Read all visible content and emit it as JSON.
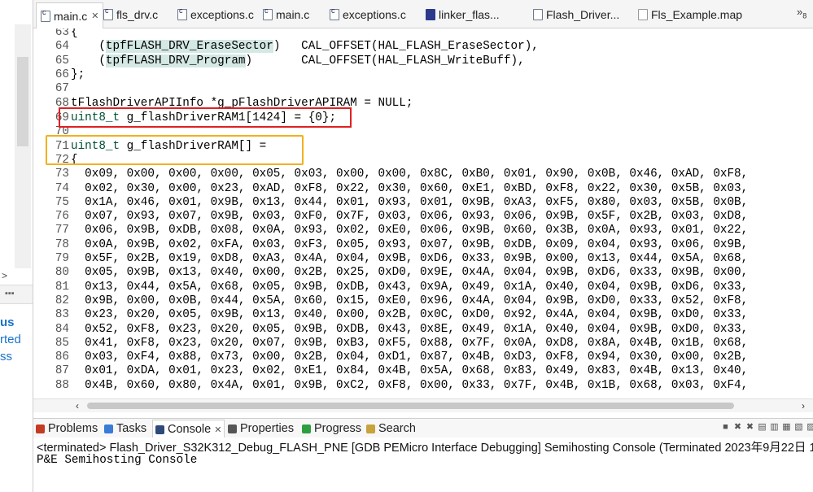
{
  "left_panel": {
    "fragments": [
      "us",
      "rted",
      "ss"
    ]
  },
  "editor_tabs": [
    {
      "label": "main.c",
      "icon": "c-file-icon",
      "active": true
    },
    {
      "label": "fls_drv.c",
      "icon": "c-file-icon"
    },
    {
      "label": "exceptions.c",
      "icon": "c-file-icon"
    },
    {
      "label": "main.c",
      "icon": "c-file-icon"
    },
    {
      "label": "exceptions.c",
      "icon": "c-file-icon"
    },
    {
      "label": "linker_flas...",
      "icon": "linker-file-icon"
    },
    {
      "label": "Flash_Driver...",
      "icon": "file-icon"
    },
    {
      "label": "Fls_Example.map",
      "icon": "map-file-icon"
    }
  ],
  "tab_overflow": {
    "symbol": "»",
    "count": "8"
  },
  "code_lines": [
    {
      "num": "63",
      "text": "{"
    },
    {
      "num": "64",
      "pre": "    (",
      "hl": "tpfFLASH_DRV_EraseSector",
      "post": ")   CAL_OFFSET(HAL_FLASH_EraseSector),"
    },
    {
      "num": "65",
      "pre": "    (",
      "hl": "tpfFLASH_DRV_Program",
      "post": ")       CAL_OFFSET(HAL_FLASH_WriteBuff),"
    },
    {
      "num": "66",
      "text": "};"
    },
    {
      "num": "67",
      "text": ""
    },
    {
      "num": "68",
      "text": "tFlashDriverAPIInfo *g_pFlashDriverAPIRAM = NULL;"
    },
    {
      "num": "69",
      "kw": "uint8_t",
      "text": " g_flashDriverRAM1[1424] = {0};"
    },
    {
      "num": "70",
      "text": ""
    },
    {
      "num": "71",
      "kw": "uint8_t",
      "text": " g_flashDriverRAM[] ="
    },
    {
      "num": "72",
      "text": "{"
    },
    {
      "num": "73",
      "text": "  0x09, 0x00, 0x00, 0x00, 0x05, 0x03, 0x00, 0x00, 0x8C, 0xB0, 0x01, 0x90, 0x0B, 0x46, 0xAD, 0xF8,"
    },
    {
      "num": "74",
      "text": "  0x02, 0x30, 0x00, 0x23, 0xAD, 0xF8, 0x22, 0x30, 0x60, 0xE1, 0xBD, 0xF8, 0x22, 0x30, 0x5B, 0x03,"
    },
    {
      "num": "75",
      "text": "  0x1A, 0x46, 0x01, 0x9B, 0x13, 0x44, 0x01, 0x93, 0x01, 0x9B, 0xA3, 0xF5, 0x80, 0x03, 0x5B, 0x0B,"
    },
    {
      "num": "76",
      "text": "  0x07, 0x93, 0x07, 0x9B, 0x03, 0xF0, 0x7F, 0x03, 0x06, 0x93, 0x06, 0x9B, 0x5F, 0x2B, 0x03, 0xD8,"
    },
    {
      "num": "77",
      "text": "  0x06, 0x9B, 0xDB, 0x08, 0x0A, 0x93, 0x02, 0xE0, 0x06, 0x9B, 0x60, 0x3B, 0x0A, 0x93, 0x01, 0x22,"
    },
    {
      "num": "78",
      "text": "  0x0A, 0x9B, 0x02, 0xFA, 0x03, 0xF3, 0x05, 0x93, 0x07, 0x9B, 0xDB, 0x09, 0x04, 0x93, 0x06, 0x9B,"
    },
    {
      "num": "79",
      "text": "  0x5F, 0x2B, 0x19, 0xD8, 0xA3, 0x4A, 0x04, 0x9B, 0xD6, 0x33, 0x9B, 0x00, 0x13, 0x44, 0x5A, 0x68,"
    },
    {
      "num": "80",
      "text": "  0x05, 0x9B, 0x13, 0x40, 0x00, 0x2B, 0x25, 0xD0, 0x9E, 0x4A, 0x04, 0x9B, 0xD6, 0x33, 0x9B, 0x00,"
    },
    {
      "num": "81",
      "text": "  0x13, 0x44, 0x5A, 0x68, 0x05, 0x9B, 0xDB, 0x43, 0x9A, 0x49, 0x1A, 0x40, 0x04, 0x9B, 0xD6, 0x33,"
    },
    {
      "num": "82",
      "text": "  0x9B, 0x00, 0x0B, 0x44, 0x5A, 0x60, 0x15, 0xE0, 0x96, 0x4A, 0x04, 0x9B, 0xD0, 0x33, 0x52, 0xF8,"
    },
    {
      "num": "83",
      "text": "  0x23, 0x20, 0x05, 0x9B, 0x13, 0x40, 0x00, 0x2B, 0x0C, 0xD0, 0x92, 0x4A, 0x04, 0x9B, 0xD0, 0x33,"
    },
    {
      "num": "84",
      "text": "  0x52, 0xF8, 0x23, 0x20, 0x05, 0x9B, 0xDB, 0x43, 0x8E, 0x49, 0x1A, 0x40, 0x04, 0x9B, 0xD0, 0x33,"
    },
    {
      "num": "85",
      "text": "  0x41, 0xF8, 0x23, 0x20, 0x07, 0x9B, 0xB3, 0xF5, 0x88, 0x7F, 0x0A, 0xD8, 0x8A, 0x4B, 0x1B, 0x68,"
    },
    {
      "num": "86",
      "text": "  0x03, 0xF4, 0x88, 0x73, 0x00, 0x2B, 0x04, 0xD1, 0x87, 0x4B, 0xD3, 0xF8, 0x94, 0x30, 0x00, 0x2B,"
    },
    {
      "num": "87",
      "text": "  0x01, 0xDA, 0x01, 0x23, 0x02, 0xE1, 0x84, 0x4B, 0x5A, 0x68, 0x83, 0x49, 0x83, 0x4B, 0x13, 0x40,"
    },
    {
      "num": "88",
      "text": "  0x4B, 0x60, 0x80, 0x4A, 0x01, 0x9B, 0xC2, 0xF8, 0x00, 0x33, 0x7F, 0x4B, 0x1B, 0x68, 0x03, 0xF4,"
    }
  ],
  "bottom_tabs": [
    {
      "label": "Problems",
      "icon": "problems-icon",
      "color": "#c23b22"
    },
    {
      "label": "Tasks",
      "icon": "tasks-icon",
      "color": "#3a7bd5"
    },
    {
      "label": "Console",
      "icon": "console-icon",
      "color": "#2e4a7a",
      "active": true
    },
    {
      "label": "Properties",
      "icon": "properties-icon",
      "color": "#555555"
    },
    {
      "label": "Progress",
      "icon": "progress-icon",
      "color": "#2e9e3e"
    },
    {
      "label": "Search",
      "icon": "search-icon",
      "color": "#c8a23a"
    }
  ],
  "console": {
    "status": "<terminated> Flash_Driver_S32K312_Debug_FLASH_PNE [GDB PEMicro Interface Debugging] Semihosting Console (Terminated 2023年9月22日 1",
    "output": "P&E Semihosting Console"
  }
}
